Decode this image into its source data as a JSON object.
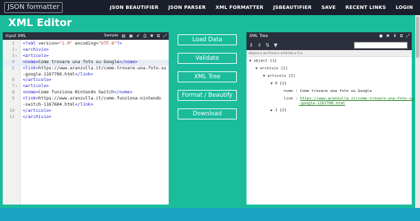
{
  "nav": {
    "logo": "JSON formatter",
    "links": [
      "JSON BEAUTIFIER",
      "JSON PARSER",
      "XML FORMATTER",
      "JSBEAUTIFIER",
      "SAVE",
      "RECENT LINKS",
      "LOGIN"
    ]
  },
  "page_title": "XML Editor",
  "input_panel": {
    "header": "Input XML",
    "sample_label": "Sample",
    "lines": [
      {
        "n": "1",
        "fold": "",
        "text": "<?xml version=\"1.0\" encoding=\"UTF-8\"?>"
      },
      {
        "n": "2",
        "fold": "▾",
        "text": "<archivio>"
      },
      {
        "n": "3",
        "fold": "▾",
        "text": "<articolo>"
      },
      {
        "n": "4",
        "fold": "",
        "text": "<nome>Come trovare una foto su Google</nome>"
      },
      {
        "n": "5",
        "fold": "",
        "text": "<link>https://www.aranzulla.it/come-trovare-una-foto-su"
      },
      {
        "n": "",
        "fold": "",
        "text": "    -google-1167786.html</link>"
      },
      {
        "n": "6",
        "fold": "",
        "text": "</articolo>"
      },
      {
        "n": "7",
        "fold": "▾",
        "text": "<articolo>"
      },
      {
        "n": "8",
        "fold": "",
        "text": "<nome>Come funziona Nintendo Switch</nome>"
      },
      {
        "n": "9",
        "fold": "",
        "text": "<link>https://www.aranzulla.it/come-funziona-nintendo"
      },
      {
        "n": "",
        "fold": "",
        "text": "    -switch-1167684.html</link>"
      },
      {
        "n": "10",
        "fold": "",
        "text": "</articolo>"
      },
      {
        "n": "11",
        "fold": "",
        "text": "</archivio>"
      }
    ]
  },
  "buttons": {
    "load_data": "Load Data",
    "validate": "Validate",
    "xml_tree": "XML Tree",
    "format_beautify": "Format / Beautify",
    "download": "Download"
  },
  "tree_panel": {
    "header": "XML Tree",
    "search_placeholder": "",
    "breadcrumb": "object ▸ archivio ▸ articolo ▸ 0 ▸",
    "nodes": {
      "root": "object {1}",
      "archivio": "archivio [1]",
      "articolo": "articolo [2]",
      "item0": "0 {2}",
      "nome_key": "nome",
      "nome_val": "Come trovare una foto su Google",
      "link_key": "link",
      "link_val_1": "https://www.aranzulla.it/come-trovare-una-foto-su",
      "link_val_2": "-google-1167786.html",
      "item1": "1 {2}"
    }
  },
  "colors": {
    "background": "#1abc9c",
    "nav": "#1a1f2b",
    "panel_header": "#2a2f3b",
    "tag": "#1b1bcc",
    "link": "#1a7a1a"
  }
}
